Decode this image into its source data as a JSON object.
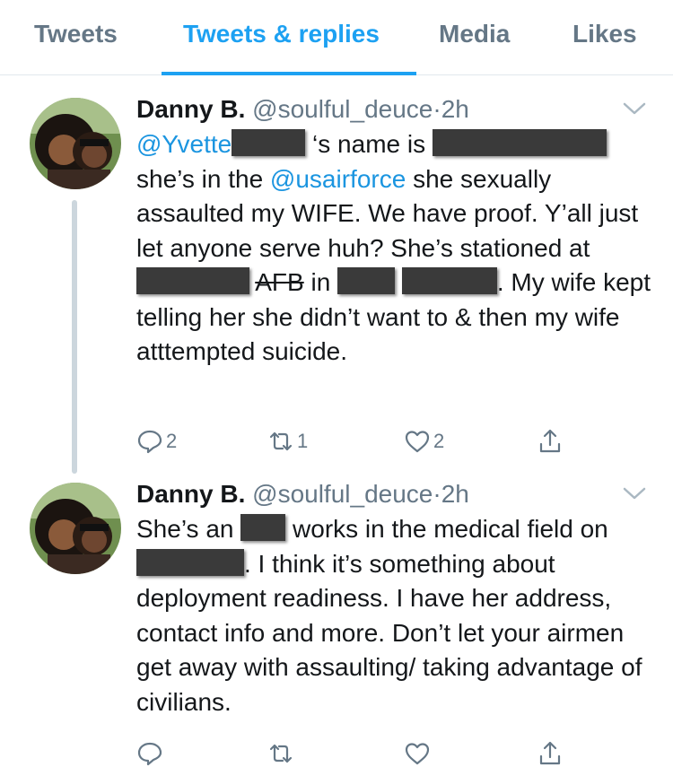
{
  "tabs": [
    {
      "label": "Tweets"
    },
    {
      "label": "Tweets & replies"
    },
    {
      "label": "Media"
    },
    {
      "label": "Likes"
    }
  ],
  "tweets": [
    {
      "name": "Danny B.",
      "handle": "@soulful_deuce",
      "dot": "·",
      "time": "2h",
      "text": {
        "mention1": "@Yvette",
        "t1": " ‘s name is ",
        "t2": "she’s in the ",
        "mention2": "@usairforce",
        "t3": " she sexually assaulted my WIFE. We have proof. Y’all just let anyone serve huh? She’s stationed at ",
        "t4": "AFB",
        "t5": " in ",
        "t6": ". My wife kept telling her she didn’t want to & then my wife atttempted suicide."
      },
      "reply_count": "2",
      "retweet_count": "1",
      "like_count": "2"
    },
    {
      "name": "Danny B.",
      "handle": "@soulful_deuce",
      "dot": "·",
      "time": "2h",
      "text": {
        "t1": "She’s an ",
        "t2": " works in the medical field on ",
        "t3": ". I think it’s something about deployment readiness. I have her address, contact info and more. Don’t let your airmen get away with assaulting/ taking advantage of civilians."
      },
      "reply_count": "",
      "retweet_count": "",
      "like_count": ""
    }
  ],
  "icons": {
    "reply": "reply-icon",
    "retweet": "retweet-icon",
    "like": "heart-icon",
    "share": "share-icon",
    "chevron": "chevron-down-icon"
  },
  "colors": {
    "accent": "#1da1f2",
    "mention": "#1b95e0",
    "muted": "#657786",
    "text": "#14171a",
    "thread_line": "#ccd6dd"
  }
}
